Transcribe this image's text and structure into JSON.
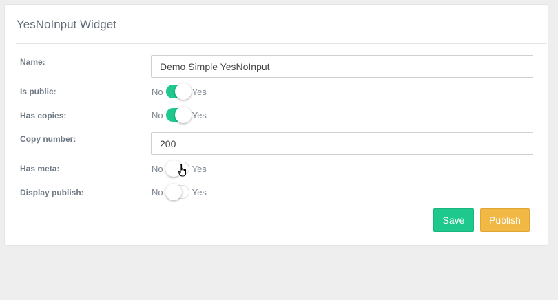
{
  "widget": {
    "title": "YesNoInput Widget"
  },
  "fields": {
    "name": {
      "label": "Name:",
      "value": "Demo Simple YesNoInput"
    },
    "is_public": {
      "label": "Is public:",
      "no_label": "No",
      "yes_label": "Yes",
      "state": "on"
    },
    "has_copies": {
      "label": "Has copies:",
      "no_label": "No",
      "yes_label": "Yes",
      "state": "on"
    },
    "copy_number": {
      "label": "Copy number:",
      "value": "200"
    },
    "has_meta": {
      "label": "Has meta:",
      "no_label": "No",
      "yes_label": "Yes",
      "state": "off"
    },
    "display_publish": {
      "label": "Display publish:",
      "no_label": "No",
      "yes_label": "Yes",
      "state": "off"
    }
  },
  "actions": {
    "save_label": "Save",
    "publish_label": "Publish"
  },
  "colors": {
    "accent_green": "#1fc98e",
    "accent_orange": "#f2b845",
    "background": "#eeeeee"
  },
  "icons": {
    "cursor": "hand-pointer-icon"
  }
}
